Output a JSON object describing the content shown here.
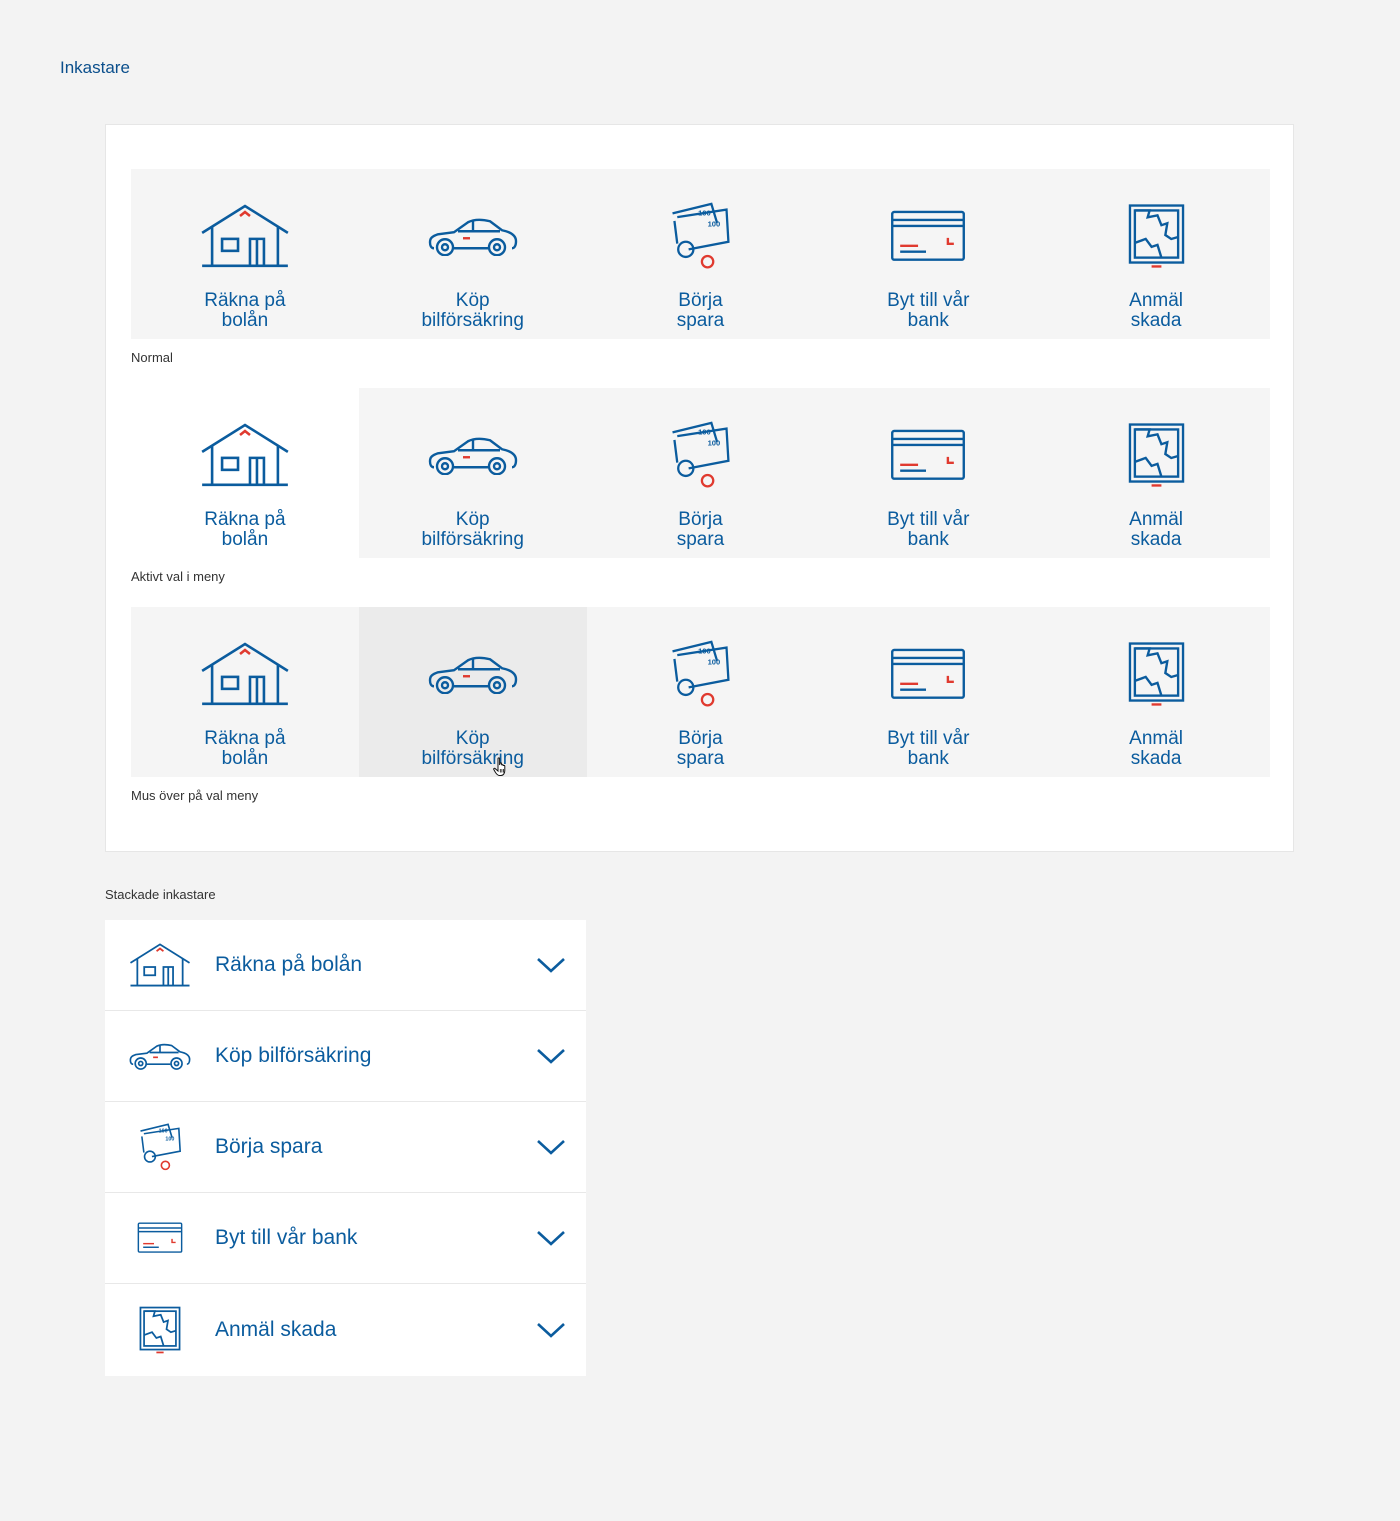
{
  "page": {
    "title": "Inkastare"
  },
  "colors": {
    "primary": "#0b5c9e",
    "accent": "#e03a2f",
    "background": "#f3f3f3"
  },
  "tiles": [
    {
      "label_line1": "Räkna på",
      "label_line2": "bolån",
      "icon": "house-icon"
    },
    {
      "label_line1": "Köp",
      "label_line2": "bilförsäkring",
      "icon": "car-icon"
    },
    {
      "label_line1": "Börja",
      "label_line2": "spara",
      "icon": "money-icon"
    },
    {
      "label_line1": "Byt till vår",
      "label_line2": "bank",
      "icon": "card-icon"
    },
    {
      "label_line1": "Anmäl",
      "label_line2": "skada",
      "icon": "broken-window-icon"
    }
  ],
  "states": {
    "normal": "Normal",
    "active": "Aktivt val i meny",
    "hover": "Mus över på val meny"
  },
  "stacked": {
    "caption": "Stackade inkastare",
    "items": [
      {
        "label": "Räkna på bolån",
        "icon": "house-icon"
      },
      {
        "label": "Köp bilförsäkring",
        "icon": "car-icon"
      },
      {
        "label": "Börja spara",
        "icon": "money-icon"
      },
      {
        "label": "Byt till vår bank",
        "icon": "card-icon"
      },
      {
        "label": "Anmäl skada",
        "icon": "broken-window-icon"
      }
    ]
  }
}
